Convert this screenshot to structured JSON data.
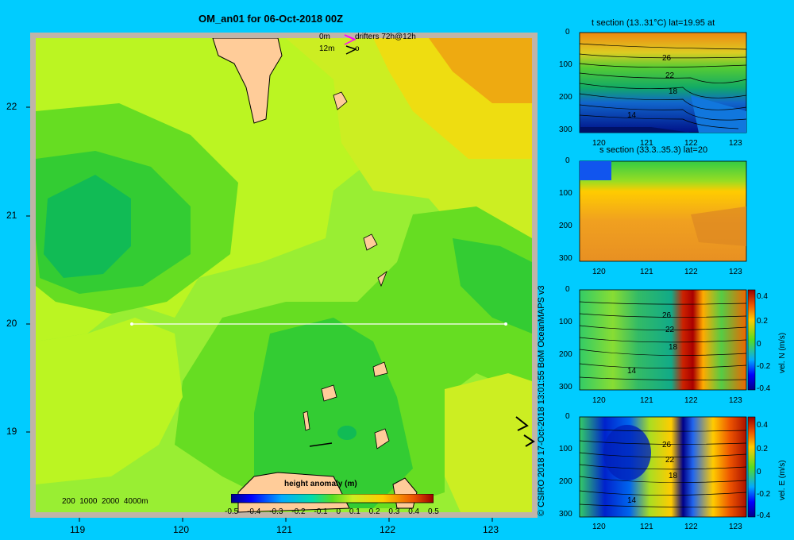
{
  "map": {
    "title": "OM_an01 for 06-Oct-2018 00Z",
    "lat_ticks": [
      "22",
      "21",
      "20",
      "19"
    ],
    "lon_ticks": [
      "119",
      "120",
      "121",
      "122",
      "123"
    ],
    "legend_line1_depth": "0m",
    "legend_line1_text": "drifters 72h@12h",
    "legend_line2_depth": "12m",
    "legend_line2_text": "o",
    "bathy_legend": "200  1000  2000  4000m",
    "colorbar_title": "height anomaly (m)",
    "colorbar_ticks": [
      "-0.5",
      "-0.4",
      "-0.3",
      "-0.2",
      "-0.1",
      "0",
      "0.1",
      "0.2",
      "0.3",
      "0.4",
      "0.5"
    ],
    "section_line": {
      "lat": 20,
      "lon_start": 119.5,
      "lon_end": 123.2
    }
  },
  "panels": [
    {
      "title": "t section (13..31°C) lat=19.95 at",
      "y_ticks": [
        "0",
        "100",
        "200",
        "300"
      ],
      "x_ticks": [
        "120",
        "121",
        "122",
        "123"
      ],
      "contour_labels": [
        "26",
        "22",
        "18",
        "14"
      ]
    },
    {
      "title": "s section (33.3..35.3) lat=20",
      "y_ticks": [
        "0",
        "100",
        "200",
        "300"
      ],
      "x_ticks": [
        "120",
        "121",
        "122",
        "123"
      ]
    },
    {
      "title": "",
      "y_ticks": [
        "0",
        "100",
        "200",
        "300"
      ],
      "x_ticks": [
        "120",
        "121",
        "122",
        "123"
      ],
      "contour_labels": [
        "26",
        "22",
        "18",
        "14"
      ],
      "cbar_label": "vel. N (m/s)",
      "cbar_ticks": [
        "0.4",
        "0.2",
        "0",
        "-0.2",
        "-0.4"
      ]
    },
    {
      "title": "",
      "y_ticks": [
        "0",
        "100",
        "200",
        "300"
      ],
      "x_ticks": [
        "120",
        "121",
        "122",
        "123"
      ],
      "contour_labels": [
        "26",
        "22",
        "18",
        "14"
      ],
      "cbar_label": "vel. E (m/s)",
      "cbar_ticks": [
        "0.4",
        "0.2",
        "0",
        "-0.2",
        "-0.4"
      ]
    }
  ],
  "credit": "© CSIRO 2018  17-Oct-2018 13:01:55 BoM OceanMAPS v3",
  "colors": {
    "background": "#00ccff",
    "land": "#ffcc99",
    "frame": "#c0b4a8"
  }
}
